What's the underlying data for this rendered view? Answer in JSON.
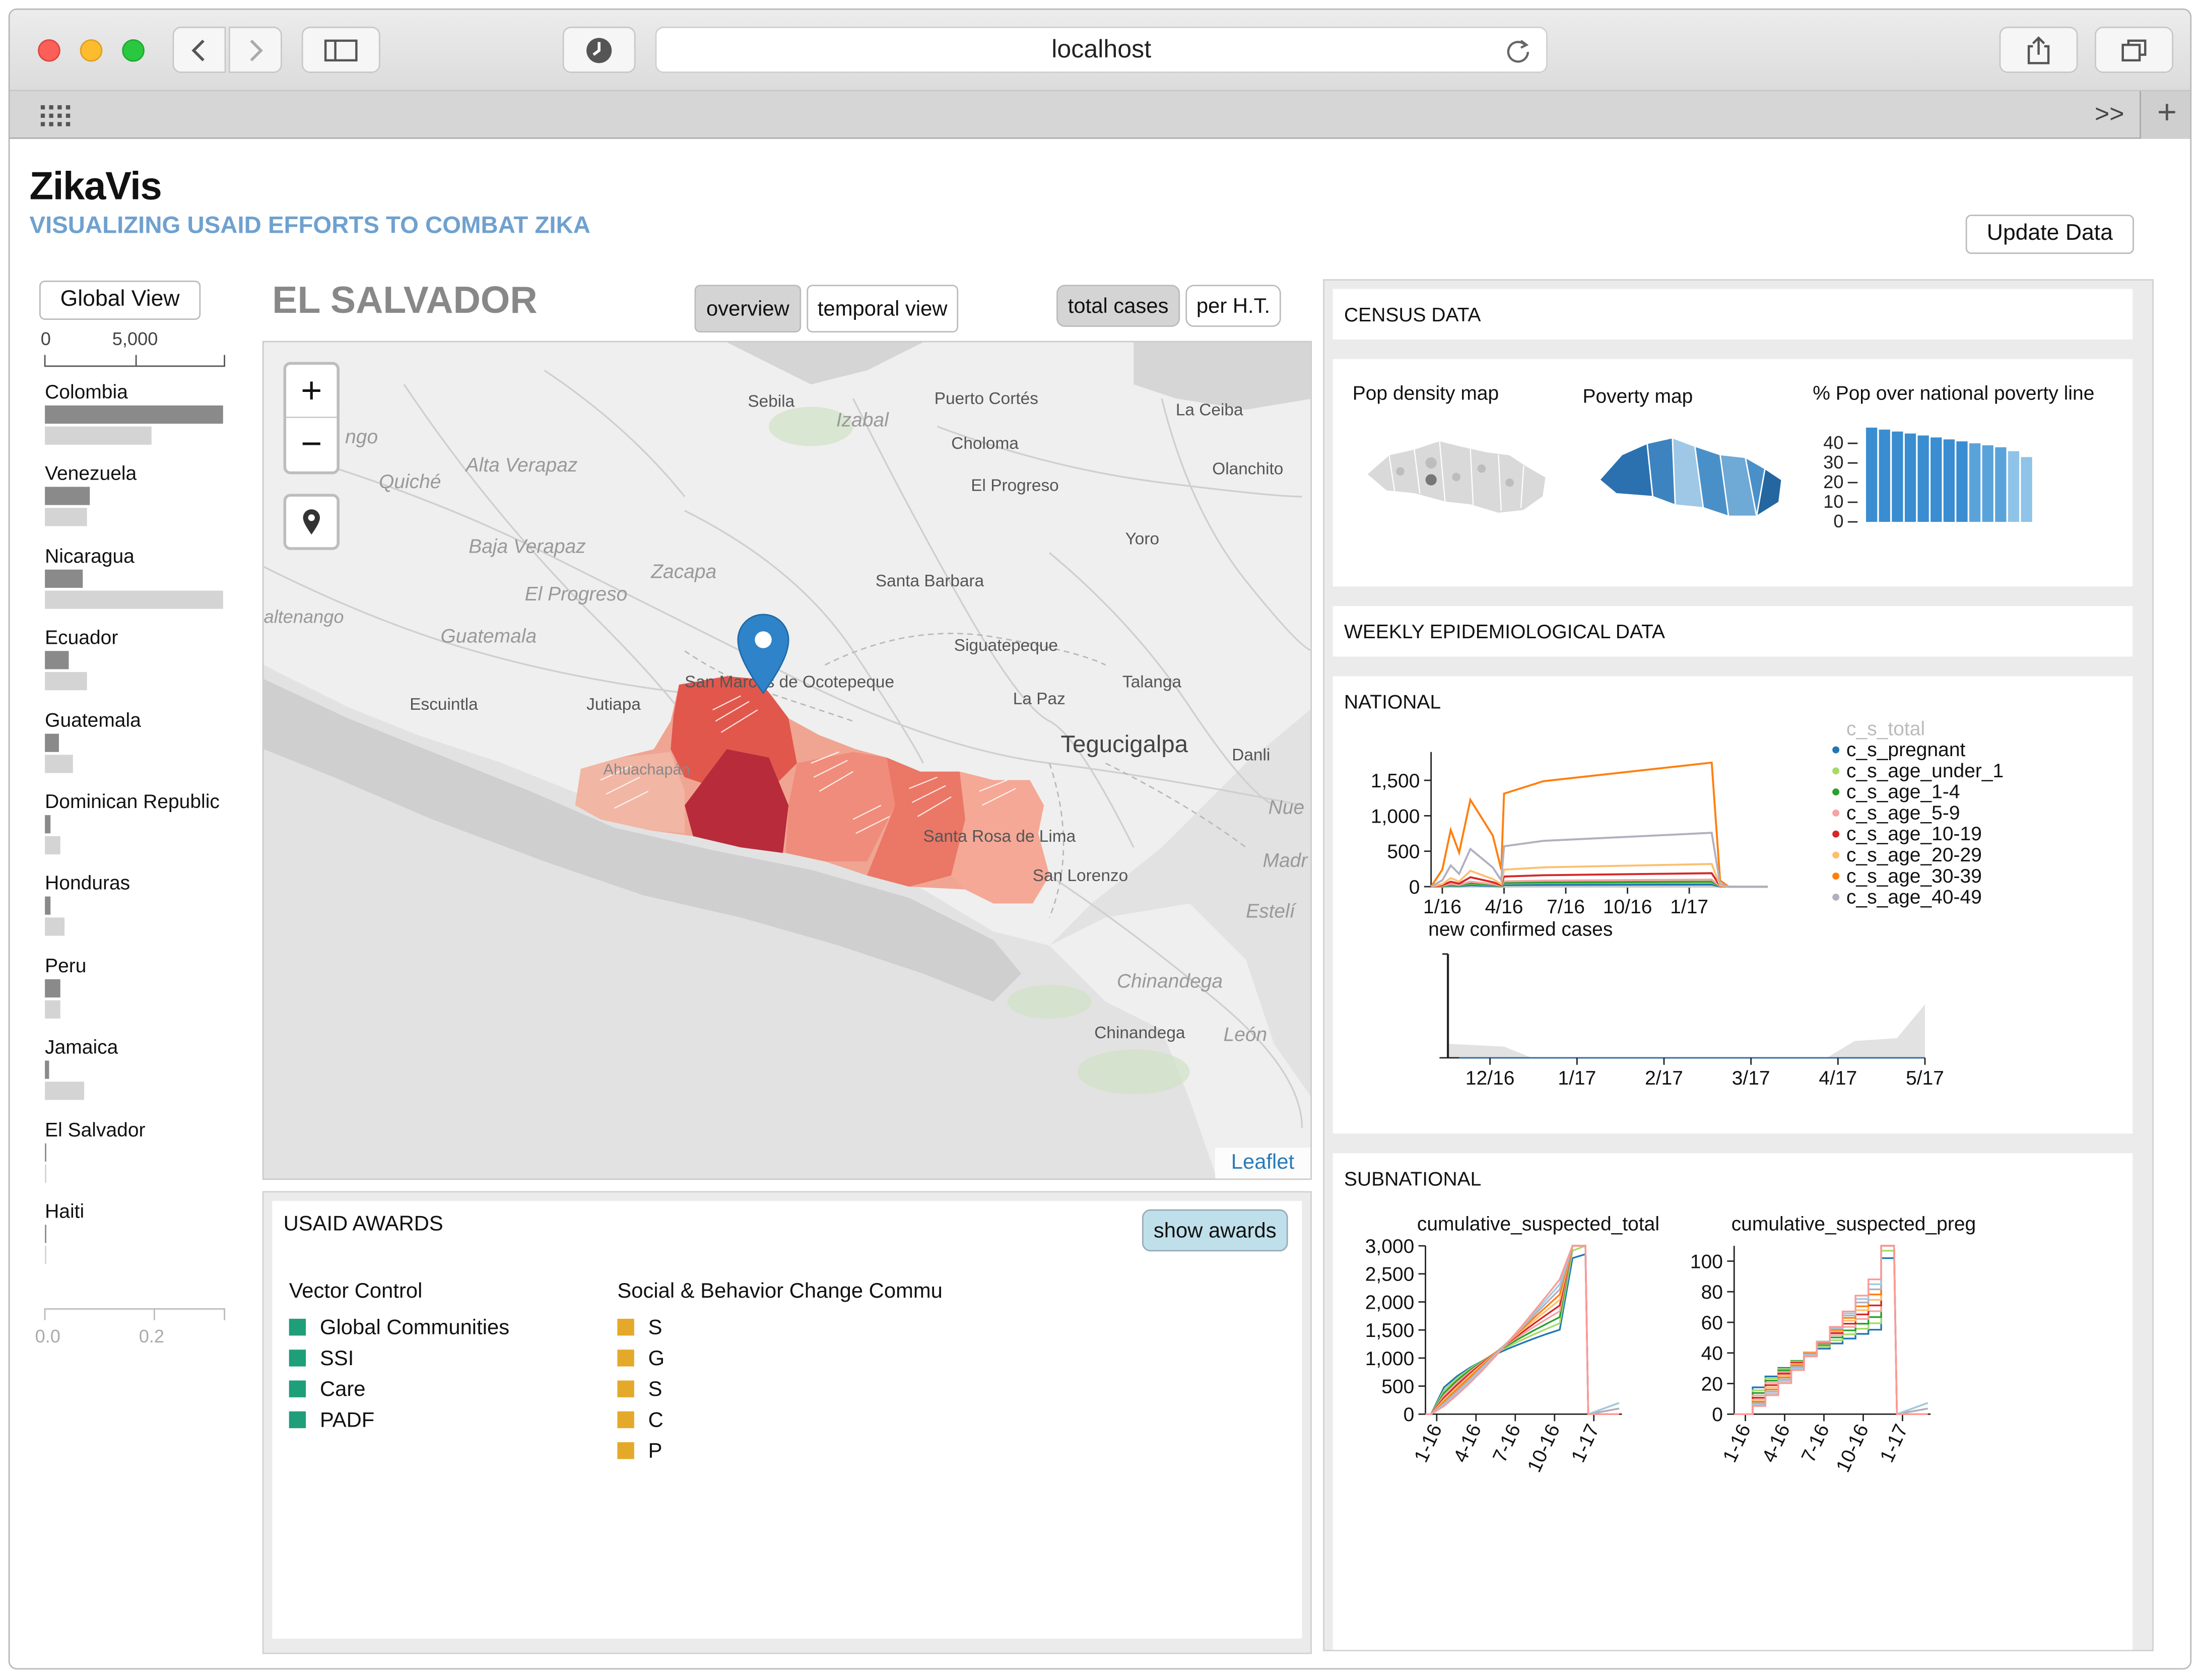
{
  "browser": {
    "url": "localhost",
    "forward_icon": ">>",
    "new_tab_icon": "+"
  },
  "app": {
    "title": "ZikaVis",
    "subtitle": "VISUALIZING USAID EFFORTS TO COMBAT ZIKA",
    "update_button": "Update Data"
  },
  "sidebar": {
    "global_view_button": "Global View",
    "top_axis_ticks": [
      "0",
      "5,000"
    ],
    "bottom_axis_ticks": [
      "0.0",
      "0.2"
    ],
    "countries": [
      {
        "name": "Colombia",
        "dark": 1.0,
        "light": 0.6
      },
      {
        "name": "Venezuela",
        "dark": 0.25,
        "light": 0.24
      },
      {
        "name": "Nicaragua",
        "dark": 0.21,
        "light": 1.0
      },
      {
        "name": "Ecuador",
        "dark": 0.13,
        "light": 0.24
      },
      {
        "name": "Guatemala",
        "dark": 0.08,
        "light": 0.16
      },
      {
        "name": "Dominican Republic",
        "dark": 0.03,
        "light": 0.09
      },
      {
        "name": "Honduras",
        "dark": 0.03,
        "light": 0.11
      },
      {
        "name": "Peru",
        "dark": 0.09,
        "light": 0.09
      },
      {
        "name": "Jamaica",
        "dark": 0.02,
        "light": 0.22
      },
      {
        "name": "El Salvador",
        "dark": 0.01,
        "light": 0.01
      },
      {
        "name": "Haiti",
        "dark": 0.0,
        "light": 0.0
      }
    ]
  },
  "map": {
    "country_title": "EL SALVADOR",
    "view_buttons": [
      "overview",
      "temporal view"
    ],
    "active_view": "overview",
    "metric_buttons": [
      "total cases",
      "per H.T."
    ],
    "active_metric": "total cases",
    "zoom_in": "+",
    "zoom_out": "−",
    "attribution": "Leaflet",
    "place_labels": [
      "Sebila",
      "Puerto Cortés",
      "La Ceiba",
      "Izabal",
      "Choloma",
      "Olanchito",
      "El Progreso",
      "Quiché",
      "Alta Verapaz",
      "Yoro",
      "Baja Verapaz",
      "Zacapa",
      "Santa Barbara",
      "El Progreso",
      "altenango",
      "Guatemala",
      "Siguatepeque",
      "San Marcos de Ocotepeque",
      "Escuintla",
      "Jutiapa",
      "La Paz",
      "Talanga",
      "Tegucigalpa",
      "Danli",
      "Ahuachapán",
      "Santa Rosa de Lima",
      "San Lorenzo",
      "Nue",
      "Madr",
      "Estelí",
      "Chinandega",
      "Chinandega",
      "León",
      "ngo"
    ]
  },
  "awards": {
    "title": "USAID AWARDS",
    "show_button": "show awards",
    "groups": [
      {
        "name": "Vector Control",
        "color": "#1f9e7a",
        "items": [
          "Global Communities",
          "SSI",
          "Care",
          "PADF"
        ]
      },
      {
        "name": "Social & Behavior Change Commu",
        "color": "#e5a92a",
        "items": [
          "S",
          "G",
          "S",
          "C",
          "P"
        ]
      }
    ]
  },
  "census": {
    "title": "CENSUS DATA",
    "pop_density_label": "Pop density map",
    "poverty_label": "Poverty map",
    "pct_label": "% Pop over national poverty line",
    "pct_ticks": [
      "40",
      "30",
      "20",
      "10",
      "0"
    ],
    "chart_data": {
      "type": "bar",
      "title": "% Pop over national poverty line",
      "values": [
        48,
        47,
        46,
        45,
        44,
        43,
        42,
        41,
        40,
        39,
        38,
        36,
        33
      ],
      "ylim": [
        0,
        50
      ]
    }
  },
  "weekly": {
    "title": "WEEKLY EPIDEMIOLOGICAL DATA",
    "national_label": "NATIONAL",
    "subnational_label": "SUBNATIONAL"
  },
  "national_chart": {
    "chart_data": {
      "type": "line",
      "x_ticks": [
        "1/16",
        "4/16",
        "7/16",
        "10/16",
        "1/17"
      ],
      "y_ticks": [
        "1,500",
        "1,000",
        "500",
        "0"
      ],
      "ylim": [
        0,
        1900
      ],
      "series": [
        {
          "name": "c_s_total",
          "color": "#cccccc"
        },
        {
          "name": "c_s_pregnant",
          "color": "#1f77b4"
        },
        {
          "name": "c_s_age_under_1",
          "color": "#a6d96a"
        },
        {
          "name": "c_s_age_1-4",
          "color": "#2ca02c"
        },
        {
          "name": "c_s_age_5-9",
          "color": "#f4a4a4"
        },
        {
          "name": "c_s_age_10-19",
          "color": "#d62728"
        },
        {
          "name": "c_s_age_20-29",
          "color": "#fdbf6f"
        },
        {
          "name": "c_s_age_30-39",
          "color": "#ff7f0e"
        },
        {
          "name": "c_s_age_40-49",
          "color": "#b0b0c0"
        }
      ]
    }
  },
  "confirmed_chart": {
    "title": "new confirmed cases",
    "chart_data": {
      "type": "area",
      "x_ticks": [
        "12/16",
        "1/17",
        "2/17",
        "3/17",
        "4/17",
        "5/17"
      ]
    }
  },
  "subnational": {
    "charts": [
      {
        "title": "cumulative_suspected_total",
        "y_ticks": [
          "3,000",
          "2,500",
          "2,000",
          "1,500",
          "1,000",
          "500",
          "0"
        ],
        "x_ticks": [
          "1-16",
          "4-16",
          "7-16",
          "10-16",
          "1-17"
        ],
        "ymax": 3000
      },
      {
        "title": "cumulative_suspected_preg",
        "y_ticks": [
          "100",
          "80",
          "60",
          "40",
          "20",
          "0"
        ],
        "x_ticks": [
          "1-16",
          "4-16",
          "7-16",
          "10-16",
          "1-17"
        ],
        "ymax": 110
      }
    ]
  }
}
